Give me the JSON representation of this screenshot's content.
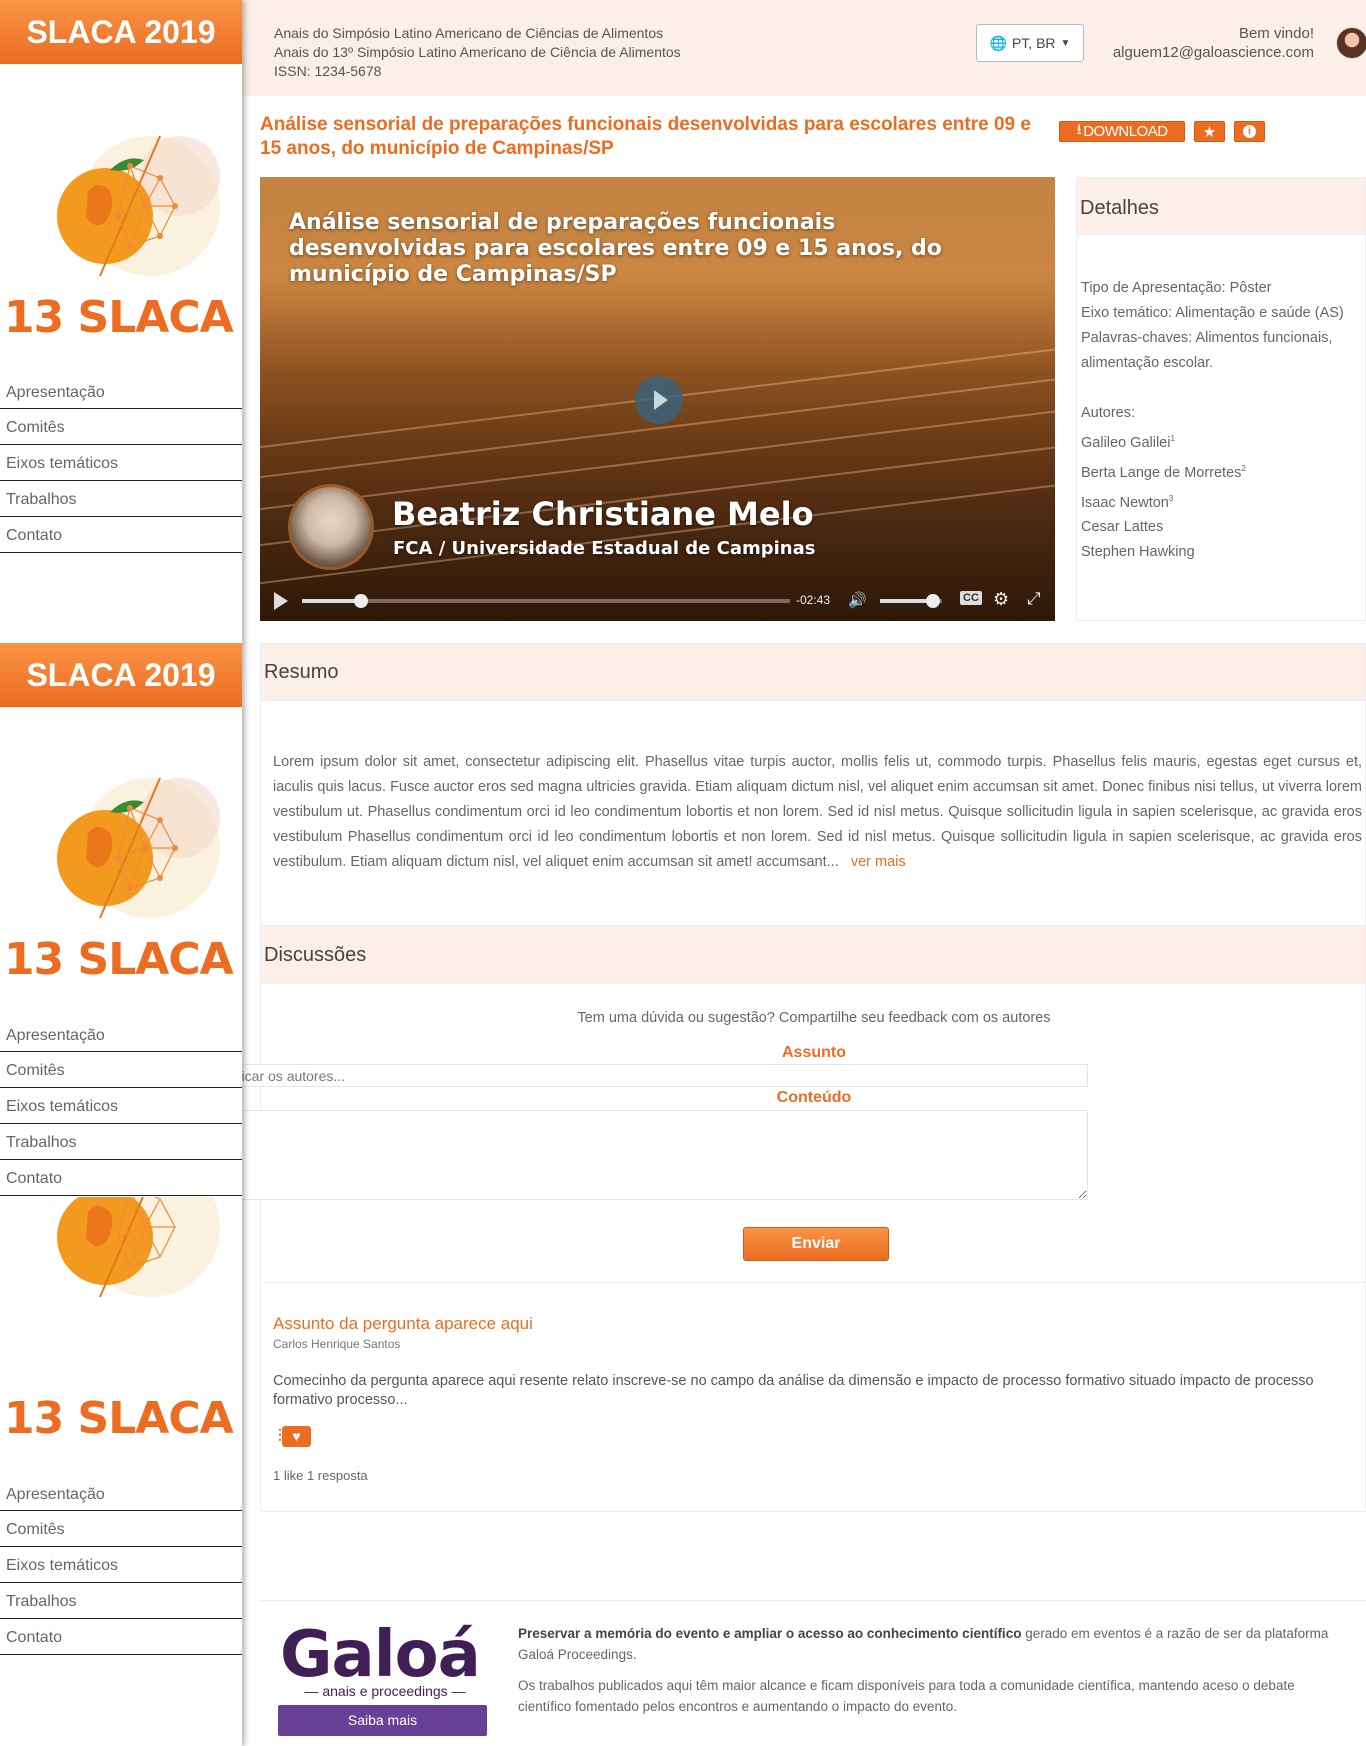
{
  "sidebar": {
    "brand": "SLACA 2019",
    "logo_text": "13 SLACA",
    "nav": [
      "Apresentação",
      "Comitês",
      "Eixos temáticos",
      "Trabalhos",
      "Contato"
    ]
  },
  "header": {
    "line1": "Anais do Simpósio Latino Americano de Ciências de Alimentos",
    "line2": "Anais do 13º Simpósio Latino Americano de Ciência de Alimentos",
    "issn": "ISSN: 1234-5678",
    "language": "PT, BR",
    "welcome": "Bem vindo!",
    "email": "alguem12@galoascience.com"
  },
  "paper": {
    "title": "Análise sensorial de preparações funcionais desenvolvidas para escolares entre 09 e 15 anos, do município de Campinas/SP",
    "download_label": "DOWNLOAD"
  },
  "video": {
    "title": "Análise sensorial de preparações funcionais desenvolvidas para escolares entre 09 e 15 anos, do município de Campinas/SP",
    "speaker_name": "Beatriz Christiane Melo",
    "speaker_institution": "FCA / Universidade Estadual de Campinas",
    "time_remaining": "-02:43",
    "progress": 0.12,
    "volume": 0.85
  },
  "details": {
    "heading": "Detalhes",
    "tipo": "Tipo de Apresentação: Pôster",
    "eixo": "Eixo temático: Alimentação e saúde (AS)",
    "palavras": "Palavras-chaves: Alimentos funcionais, alimentação escolar.",
    "autores_label": "Autores:",
    "authors": [
      {
        "name": "Galileo Galilei",
        "sup": "1"
      },
      {
        "name": "Berta Lange de Morretes",
        "sup": "2"
      },
      {
        "name": "Isaac Newton",
        "sup": "3"
      },
      {
        "name": "Cesar Lattes",
        "sup": ""
      },
      {
        "name": "Stephen Hawking",
        "sup": ""
      }
    ]
  },
  "resumo": {
    "heading": "Resumo",
    "text": "Lorem ipsum dolor sit amet, consectetur adipiscing elit. Phasellus vitae turpis auctor, mollis felis ut, commodo turpis. Phasellus felis mauris, egestas eget cursus et, iaculis quis lacus. Fusce auctor eros sed magna ultricies gravida. Etiam aliquam dictum nisl, vel aliquet enim accumsan sit amet. Donec finibus nisi tellus, ut viverra lorem vestibulum ut. Phasellus condimentum orci id leo condimentum lobortis et non lorem. Sed id nisl metus. Quisque sollicitudin ligula in sapien scelerisque, ac gravida eros vestibulum Phasellus condimentum orci id leo condimentum lobortis et non lorem. Sed id nisl metus. Quisque sollicitudin ligula in sapien scelerisque, ac gravida eros vestibulum. Etiam aliquam dictum nisl, vel aliquet enim accumsan sit amet! accumsant...",
    "more": "ver mais"
  },
  "discussoes": {
    "heading": "Discussões",
    "prompt": "Tem uma dúvida ou sugestão? Compartilhe seu feedback com os autores",
    "subject_label": "Assunto",
    "subject_placeholder": "Defina um tópico sucinto para notificar os autores...",
    "content_label": "Conteúdo",
    "send": "Enviar",
    "question": {
      "title": "Assunto da pergunta aparece aqui",
      "author": "Carlos Henrique Santos",
      "body": "Comecinho da pergunta aparece aqui resente relato inscreve-se no campo da análise da dimensão e impacto de processo formativo situado impacto de processo formativo processo...",
      "stats": "1 like 1 resposta"
    }
  },
  "footer": {
    "logo": "Galoá",
    "logo_sub": "— anais e proceedings —",
    "saiba": "Saiba mais",
    "p1_bold": "Preservar a memória do evento e ampliar o acesso ao conhecimento científico",
    "p1_rest": " gerado em eventos é a razão de ser da plataforma Galoá Proceedings.",
    "p2": "Os trabalhos publicados aqui têm maior alcance e ficam disponíveis para toda a comunidade científica, mantendo aceso o debate científico fomentado pelos encontros e aumentando o impacto do evento."
  },
  "colors": {
    "accent": "#ec6c21",
    "header_bg": "#fcefe7",
    "galoa_purple": "#3f1f56"
  }
}
